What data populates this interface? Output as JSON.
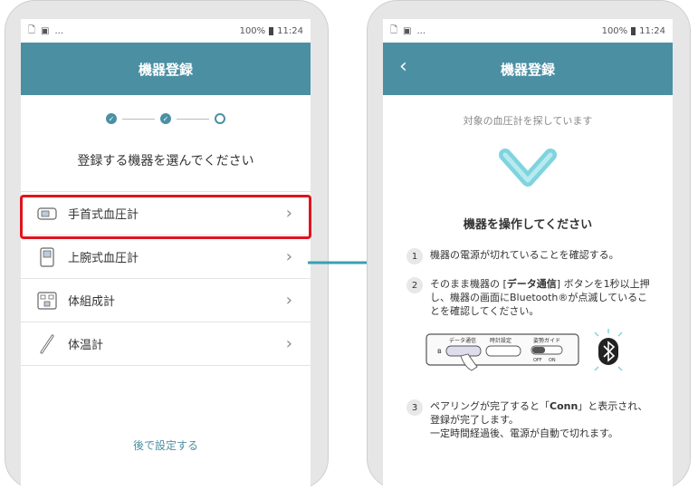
{
  "status": {
    "battery": "100%",
    "time": "11:24",
    "dots": "..."
  },
  "left": {
    "title": "機器登録",
    "heading": "登録する機器を選んでください",
    "devices": [
      {
        "label": "手首式血圧計",
        "icon": "wrist-bp-icon"
      },
      {
        "label": "上腕式血圧計",
        "icon": "upper-arm-bp-icon"
      },
      {
        "label": "体組成計",
        "icon": "body-composition-icon"
      },
      {
        "label": "体温計",
        "icon": "thermometer-icon"
      }
    ],
    "later": "後で設定する"
  },
  "right": {
    "title": "機器登録",
    "back": "‹",
    "searching": "対象の血圧計を探しています",
    "op_title": "機器を操作してください",
    "steps": [
      {
        "num": "1",
        "text": "機器の電源が切れていることを確認する。"
      },
      {
        "num": "2",
        "text_a": "そのまま機器の [",
        "bold": "データ通信",
        "text_b": "] ボタンを1秒以上押し、機器の画面にBluetooth®が点滅していることを確認してください。"
      },
      {
        "num": "3",
        "text_a": "ペアリングが完了すると「",
        "bold": "Conn",
        "text_b": "」と表示され、登録が完了します。",
        "text_c": "一定時間経過後、電源が自動で切れます。"
      }
    ],
    "device_labels": {
      "data": "データ通信",
      "clock": "時計設定",
      "guide": "姿勢ガイド",
      "off": "OFF",
      "on": "ON"
    }
  },
  "colors": {
    "accent": "#4b8fa3",
    "highlight": "#e0141e",
    "logo": "#7fd4de"
  }
}
